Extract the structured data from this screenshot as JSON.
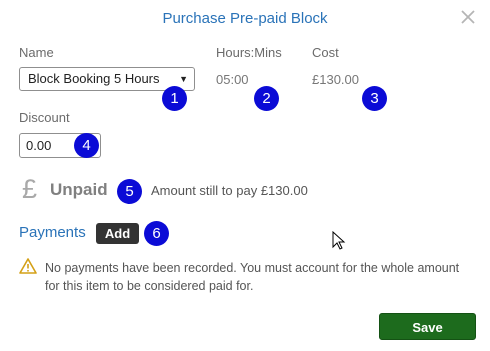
{
  "dialog": {
    "title": "Purchase Pre-paid Block"
  },
  "fields": {
    "name_label": "Name",
    "name_value": "Block Booking 5 Hours",
    "hours_label": "Hours:Mins",
    "hours_value": "05:00",
    "cost_label": "Cost",
    "cost_value": "£130.00",
    "discount_label": "Discount",
    "discount_value": "0.00"
  },
  "status": {
    "currency_symbol": "£",
    "state": "Unpaid",
    "remaining_text": "Amount still to pay £130.00"
  },
  "payments": {
    "heading": "Payments",
    "add_label": "Add",
    "warning_text": "No payments have been recorded. You must account for the whole amount for this item to be considered paid for."
  },
  "footer": {
    "save_label": "Save"
  },
  "annotations": [
    "1",
    "2",
    "3",
    "4",
    "5",
    "6"
  ],
  "icons": {
    "close": "close-icon",
    "warning": "warning-triangle-icon",
    "pound": "pound-sign-icon",
    "cursor": "mouse-cursor-icon"
  },
  "colors": {
    "accent": "#2a73b8",
    "badge": "#0b0bd6",
    "save": "#1d6b1d",
    "add": "#333333",
    "warning": "#d4a017"
  }
}
